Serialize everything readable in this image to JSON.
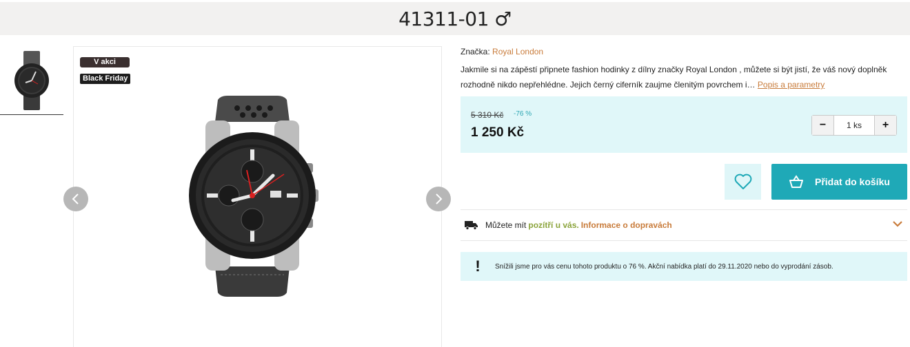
{
  "product": {
    "title": "41311-01 ♂",
    "badges": [
      "V akci",
      "Black Friday"
    ],
    "brand_label": "Značka:",
    "brand_name": "Royal London",
    "description": "Jakmile si na zápěstí připnete fashion hodinky z dílny značky Royal London , můžete si být jistí, že váš nový doplněk rozhodně nikdo nepřehlédne. Jejich černý ciferník zaujme členitým povrchem i…",
    "description_link": "Popis a parametry"
  },
  "price": {
    "old": "5 310 Kč",
    "discount": "-76 %",
    "current": "1 250 Kč"
  },
  "quantity": {
    "minus": "−",
    "value": "1 ks",
    "plus": "+"
  },
  "actions": {
    "cart_label": "Přidat do košíku"
  },
  "delivery": {
    "prefix": "Můžete mít",
    "highlight": "pozítří u vás.",
    "link": "Informace o dopravách"
  },
  "notice": {
    "icon": "!",
    "text": "Snížili jsme pro vás cenu tohoto produktu o 76 %. Akční nabídka platí do 29.11.2020 nebo do vyprodání zásob."
  },
  "colors": {
    "accent": "#1fa9b7",
    "light_accent": "#e0f7f9",
    "link": "#c87b3a",
    "green": "#8aa33a"
  },
  "icons": [
    "chevron-left-icon",
    "chevron-right-icon",
    "heart-icon",
    "basket-icon",
    "truck-icon",
    "chevron-down-icon",
    "exclamation-icon"
  ]
}
